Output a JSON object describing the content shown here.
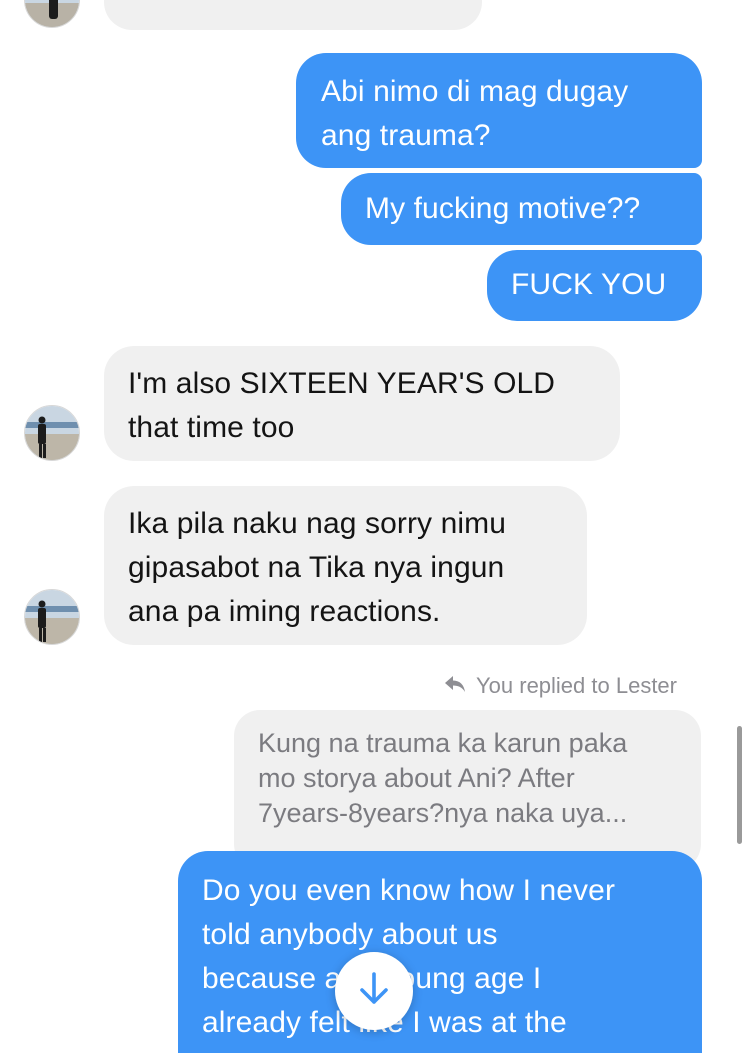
{
  "messages": [
    {
      "direction": "outgoing",
      "text": "Abi nimo di mag dugay\nang trauma?"
    },
    {
      "direction": "outgoing",
      "text": "My fucking motive??"
    },
    {
      "direction": "outgoing",
      "text": "FUCK YOU"
    },
    {
      "direction": "incoming",
      "text": "I'm also SIXTEEN YEAR'S OLD\nthat time too"
    },
    {
      "direction": "incoming",
      "text": "Ika pila naku nag sorry nimu\ngipasabot na Tika nya ingun\nana pa iming reactions."
    },
    {
      "direction": "outgoing",
      "text": "Do you even know how I never\ntold anybody about us\nbecause at a young age I\nalready felt like I was at the"
    }
  ],
  "reply": {
    "label": "You replied to Lester",
    "icon": "reply-arrow-icon",
    "quoted_text": "Kung na trauma ka karun paka\nmo storya about Ani? After\n7years-8years?nya naka uya..."
  },
  "scroll_down_icon": "arrow-down-icon",
  "colors": {
    "outgoing_bubble": "#3d94f6",
    "incoming_bubble": "#f0f0f0",
    "quoted_text": "#7b7b80",
    "meta_text": "#8e8e93"
  }
}
